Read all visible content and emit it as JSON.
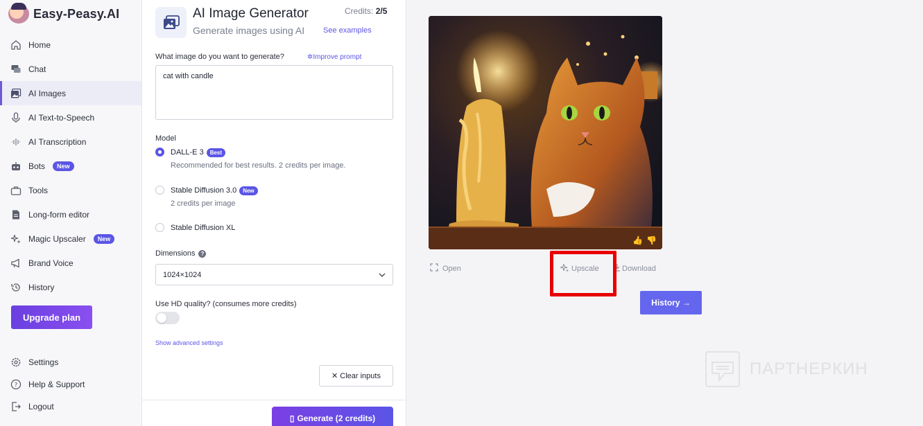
{
  "app": {
    "name": "Easy-Peasy.AI"
  },
  "sidebar": {
    "items": [
      {
        "label": "Home",
        "icon": "home-icon"
      },
      {
        "label": "Chat",
        "icon": "chat-icon"
      },
      {
        "label": "AI Images",
        "icon": "images-icon",
        "active": true
      },
      {
        "label": "AI Text-to-Speech",
        "icon": "microphone-icon"
      },
      {
        "label": "AI Transcription",
        "icon": "soundwave-icon"
      },
      {
        "label": "Bots",
        "icon": "robot-icon",
        "badge": "New"
      },
      {
        "label": "Tools",
        "icon": "briefcase-icon"
      },
      {
        "label": "Long-form editor",
        "icon": "document-icon"
      },
      {
        "label": "Magic Upscaler",
        "icon": "sparkles-icon",
        "badge": "New"
      },
      {
        "label": "Brand Voice",
        "icon": "megaphone-icon"
      },
      {
        "label": "History",
        "icon": "history-icon"
      }
    ],
    "upgrade_label": "Upgrade plan",
    "bottom": [
      {
        "label": "Settings",
        "icon": "gear-icon"
      },
      {
        "label": "Help & Support",
        "icon": "help-icon"
      },
      {
        "label": "Logout",
        "icon": "logout-icon"
      }
    ]
  },
  "tool": {
    "title": "AI Image Generator",
    "subtitle": "Generate images using AI",
    "examples_link": "See examples",
    "credits_label": "Credits:",
    "credits_value": "2/5"
  },
  "form": {
    "prompt_label": "What image do you want to generate?",
    "improve_prompt": "Improve prompt",
    "prompt_value": "cat with candle",
    "model_label": "Model",
    "models": [
      {
        "name": "DALL-E 3",
        "badge": "Best",
        "desc": "Recommended for best results. 2 credits per image.",
        "selected": true
      },
      {
        "name": "Stable Diffusion 3.0",
        "badge": "New",
        "desc": "2 credits per image",
        "selected": false
      },
      {
        "name": "Stable Diffusion XL",
        "badge": "",
        "desc": "",
        "selected": false
      }
    ],
    "dimensions_label": "Dimensions",
    "dimensions_value": "1024×1024",
    "hd_label": "Use HD quality? (consumes more credits)",
    "hd_enabled": false,
    "advanced_link": "Show advanced settings",
    "clear_label": "Clear inputs",
    "generate_label": "Generate (2 credits)"
  },
  "result": {
    "actions": {
      "open": "Open",
      "upscale": "Upscale",
      "download": "Download"
    },
    "history_label": "History →"
  },
  "watermark": {
    "text": "ПАРТНЕРКИН"
  },
  "colors": {
    "accent": "#5b55e6",
    "highlight": "#e80000",
    "history_button": "#6466ee"
  }
}
